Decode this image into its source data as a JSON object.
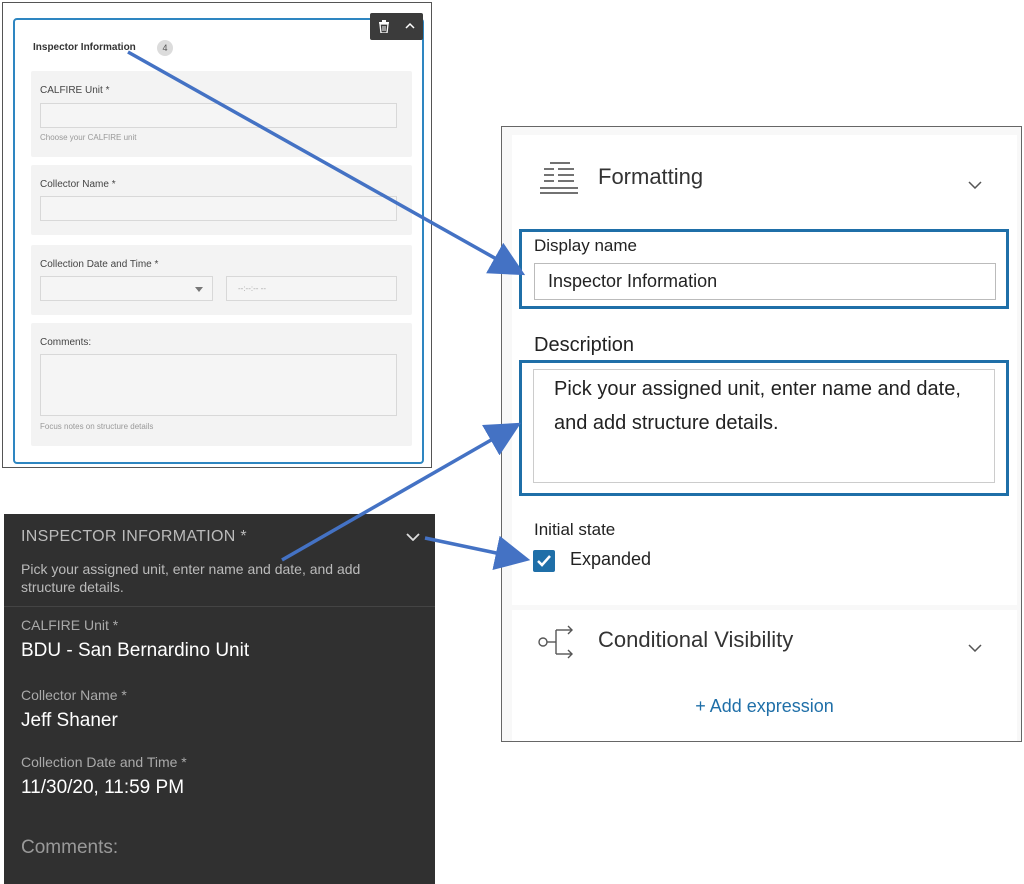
{
  "builder": {
    "group_title": "Inspector Information",
    "group_count": "4",
    "questions": [
      {
        "label": "CALFIRE Unit *",
        "hint": "Choose your CALFIRE unit"
      },
      {
        "label": "Collector Name *",
        "hint": ""
      },
      {
        "label": "Collection Date and Time *",
        "time_placeholder": "--:--:-- --"
      },
      {
        "label": "Comments:",
        "hint": "Focus notes on structure details"
      }
    ]
  },
  "properties": {
    "formatting_title": "Formatting",
    "display_name_label": "Display name",
    "display_name_value": "Inspector Information",
    "description_label": "Description",
    "description_value": "Pick your assigned unit, enter name and date, and add structure details.",
    "initial_state_label": "Initial state",
    "expanded_label": "Expanded",
    "expanded_checked": true,
    "conditional_title": "Conditional Visibility",
    "add_expression": "+ Add expression"
  },
  "mobile": {
    "title": "INSPECTOR INFORMATION *",
    "description": "Pick your assigned unit, enter name and date, and add structure details.",
    "fields": [
      {
        "label": "CALFIRE Unit *",
        "value": "BDU - San Bernardino Unit"
      },
      {
        "label": "Collector Name *",
        "value": "Jeff Shaner"
      },
      {
        "label": "Collection Date and Time *",
        "value": "11/30/20, 11:59 PM"
      }
    ],
    "comments_label": "Comments:"
  },
  "colors": {
    "accent": "#1f6fa8",
    "arrow": "#4472c4",
    "mobile_bg": "#303030"
  },
  "icons": [
    "trash-icon",
    "chevron-up-icon",
    "chevron-down-icon",
    "formatting-icon",
    "conditional-visibility-icon",
    "checkmark-icon",
    "dropdown-caret-icon"
  ]
}
